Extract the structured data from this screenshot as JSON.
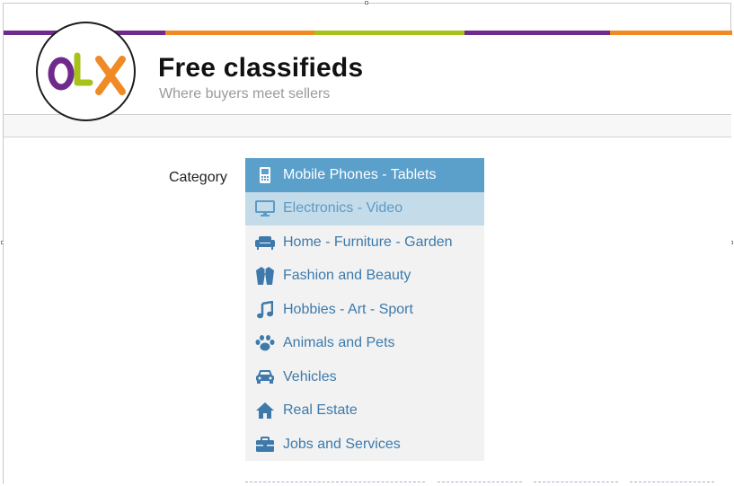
{
  "header": {
    "logo_text": "OLX",
    "title": "Free classifieds",
    "tagline": "Where buyers meet sellers",
    "stripe_colors": [
      "#6f2b8c",
      "#f08a24",
      "#a8c219",
      "#6f2b8c",
      "#f08a24"
    ]
  },
  "form": {
    "category_label": "Category"
  },
  "categories": [
    {
      "label": "Mobile Phones - Tablets",
      "icon": "phone-icon",
      "state": "selected"
    },
    {
      "label": "Electronics - Video",
      "icon": "monitor-icon",
      "state": "hover"
    },
    {
      "label": "Home - Furniture - Garden",
      "icon": "sofa-icon",
      "state": "normal"
    },
    {
      "label": "Fashion and Beauty",
      "icon": "jacket-icon",
      "state": "normal"
    },
    {
      "label": "Hobbies - Art - Sport",
      "icon": "music-note-icon",
      "state": "normal"
    },
    {
      "label": "Animals and Pets",
      "icon": "paw-icon",
      "state": "normal"
    },
    {
      "label": "Vehicles",
      "icon": "car-icon",
      "state": "normal"
    },
    {
      "label": "Real Estate",
      "icon": "house-icon",
      "state": "normal"
    },
    {
      "label": "Jobs and Services",
      "icon": "briefcase-icon",
      "state": "normal"
    }
  ],
  "colors": {
    "selected_bg": "#5b9fcb",
    "hover_bg": "#c4dbe9",
    "link_text": "#3d7aab",
    "logo_o": "#6f2b8c",
    "logo_l": "#a8c219",
    "logo_x": "#f08a24"
  }
}
